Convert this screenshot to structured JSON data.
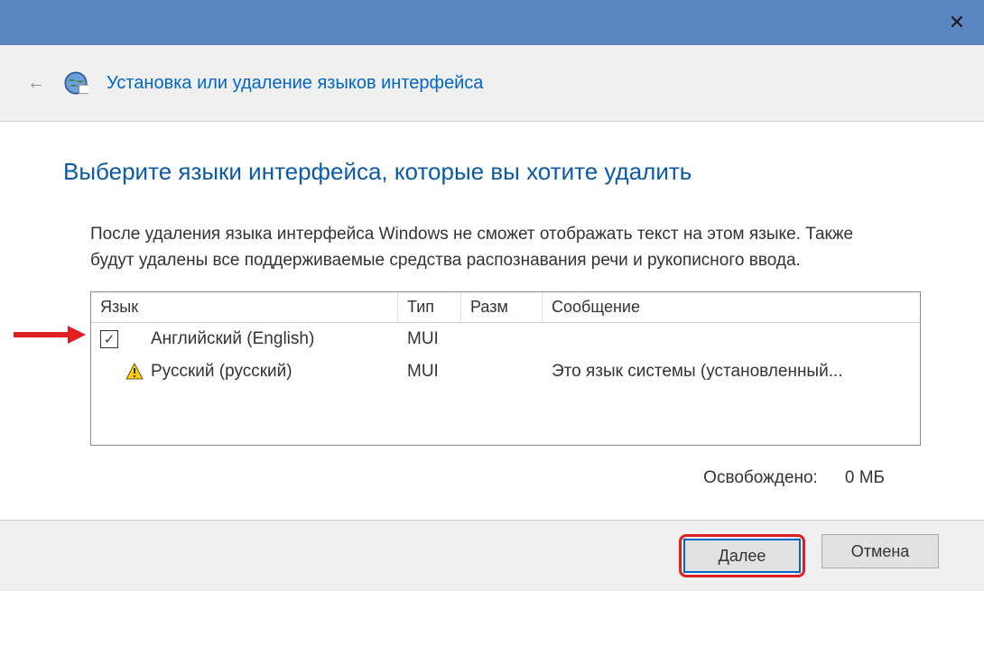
{
  "titlebar": {
    "close": "✕"
  },
  "header": {
    "title": "Установка или удаление языков интерфейса"
  },
  "main": {
    "heading": "Выберите языки интерфейса, которые вы хотите удалить",
    "description": "После удаления языка интерфейса Windows не сможет отображать текст на этом языке. Также будут удалены все поддерживаемые средства распознавания речи и рукописного ввода."
  },
  "table": {
    "columns": {
      "lang": "Язык",
      "type": "Тип",
      "size": "Разм",
      "msg": "Сообщение"
    },
    "rows": [
      {
        "checked": true,
        "icon": "check",
        "name": "Английский (English)",
        "type": "MUI",
        "size": "",
        "msg": ""
      },
      {
        "checked": false,
        "icon": "warning",
        "name": "Русский (русский)",
        "type": "MUI",
        "size": "",
        "msg": "Это язык системы (установленный..."
      }
    ]
  },
  "status": {
    "freed_label": "Освобождено:",
    "freed_value": "0 МБ"
  },
  "buttons": {
    "next": "Далее",
    "cancel": "Отмена"
  }
}
